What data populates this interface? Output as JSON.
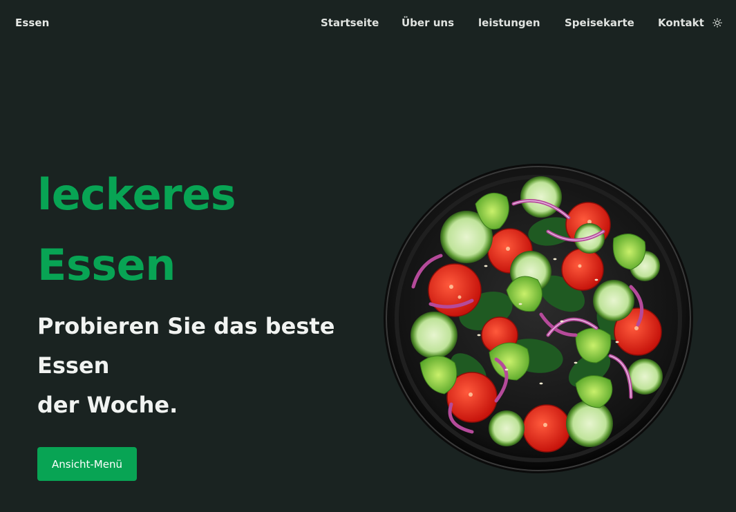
{
  "header": {
    "brand": "Essen",
    "nav": [
      "Startseite",
      "Über uns",
      "leistungen",
      "Speisekarte",
      "Kontakt"
    ],
    "theme_icon": "sun-icon"
  },
  "hero": {
    "title_line1": "leckeres",
    "title_line2": "Essen",
    "subtitle_lines": [
      "Probieren Sie das beste",
      "Essen",
      "der Woche."
    ],
    "button_label": "Ansicht-Menü",
    "image": "salad-bowl-image"
  },
  "colors": {
    "background": "#1a2321",
    "accent": "#08a454",
    "text": "#f1f3f1"
  }
}
